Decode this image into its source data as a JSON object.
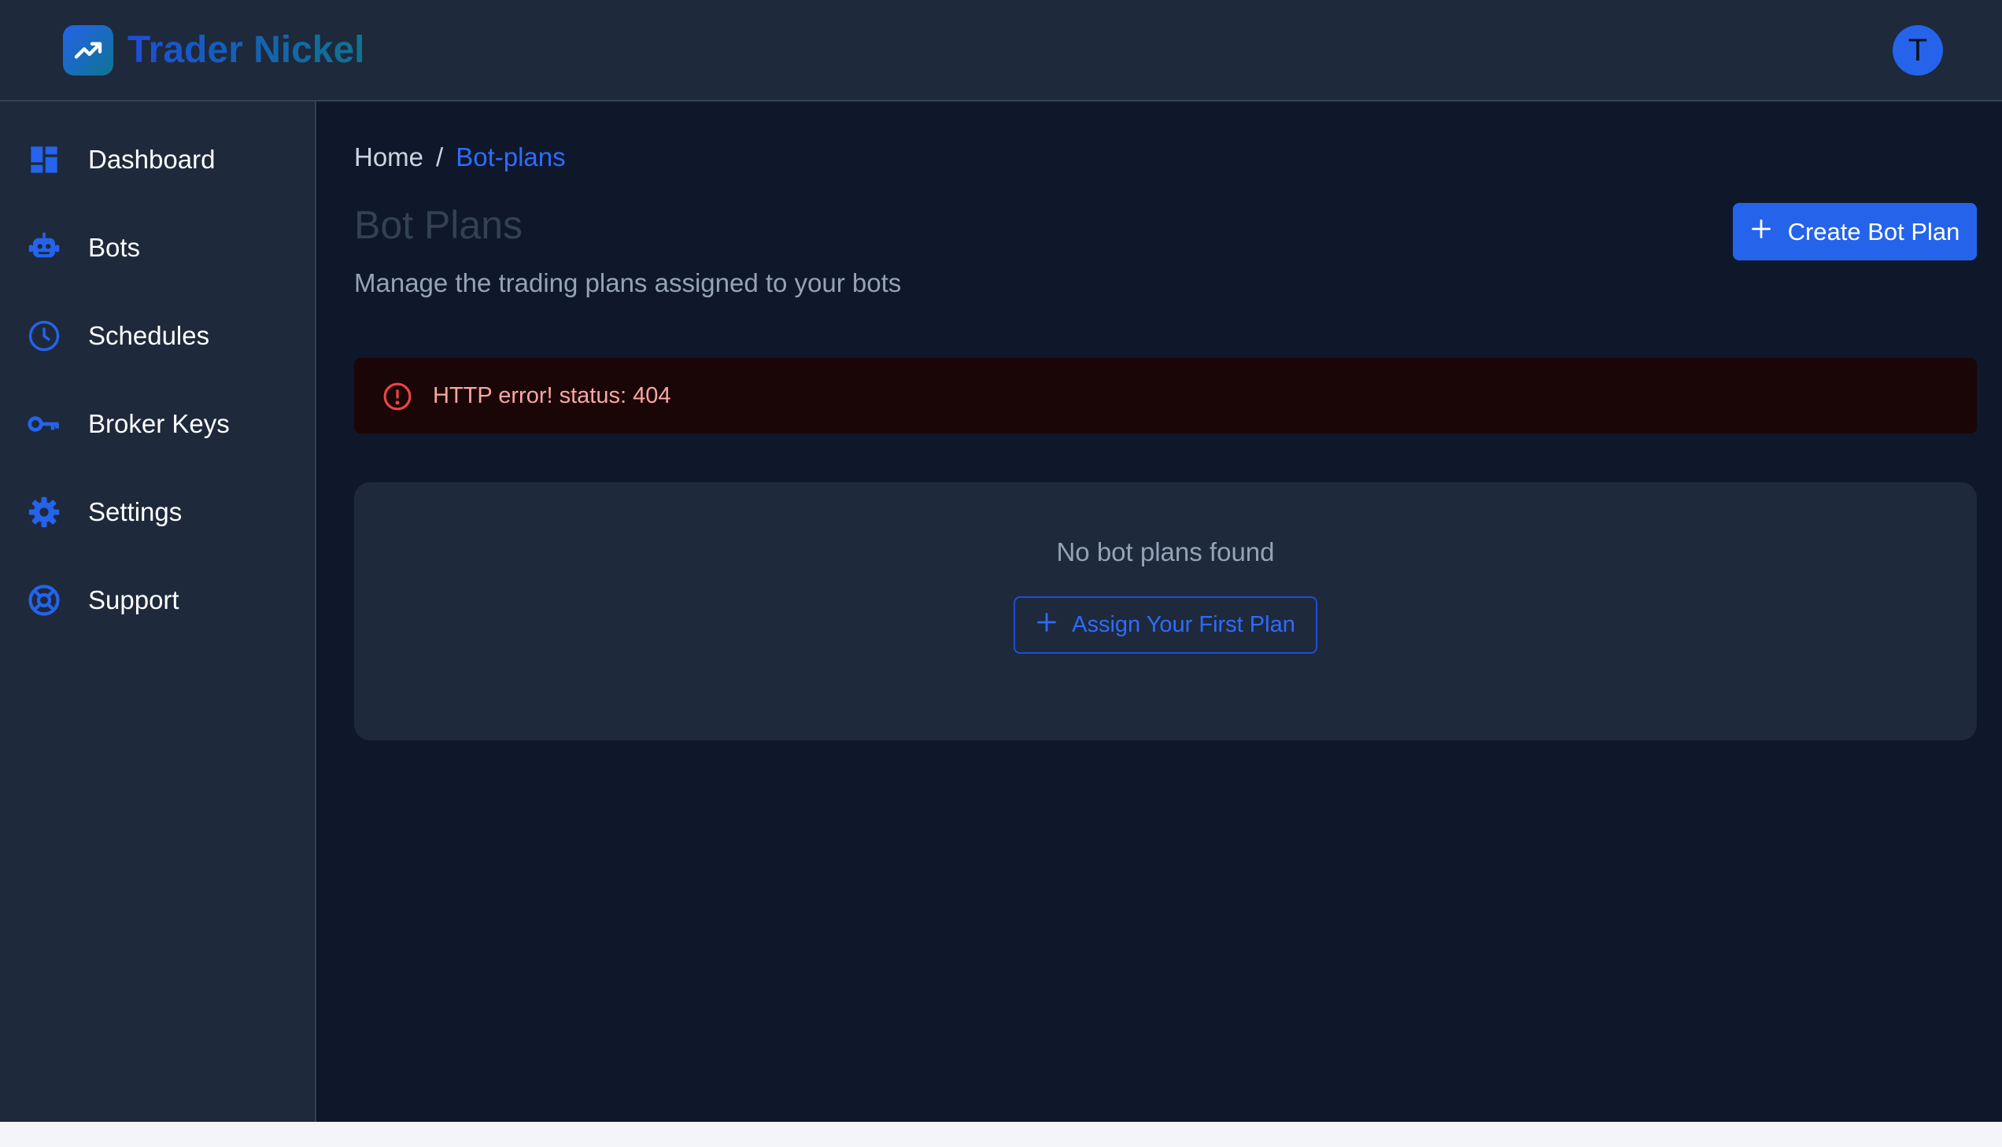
{
  "app": {
    "brand": "Trader Nickel",
    "avatar_initial": "T"
  },
  "colors": {
    "accent": "#2563eb",
    "background": "#0f172a",
    "surface": "#1e293b",
    "error": "#ef4444"
  },
  "sidebar": {
    "items": [
      {
        "label": "Dashboard",
        "icon": "dashboard-icon"
      },
      {
        "label": "Bots",
        "icon": "robot-icon"
      },
      {
        "label": "Schedules",
        "icon": "clock-icon"
      },
      {
        "label": "Broker Keys",
        "icon": "key-icon"
      },
      {
        "label": "Settings",
        "icon": "gear-icon"
      },
      {
        "label": "Support",
        "icon": "lifebuoy-icon"
      }
    ]
  },
  "breadcrumb": {
    "home": "Home",
    "separator": "/",
    "current": "Bot-plans"
  },
  "page": {
    "title": "Bot Plans",
    "subtitle": "Manage the trading plans assigned to your bots",
    "create_button": "Create Bot Plan"
  },
  "alert": {
    "message": "HTTP error! status: 404",
    "icon": "error-icon"
  },
  "empty_state": {
    "message": "No bot plans found",
    "button": "Assign Your First Plan"
  }
}
